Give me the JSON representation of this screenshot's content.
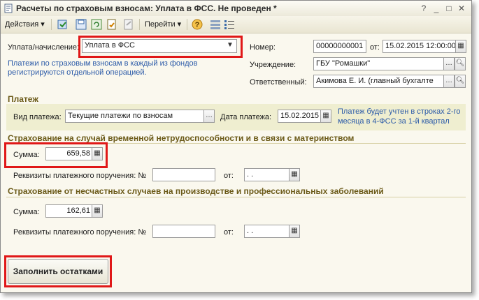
{
  "window": {
    "title": "Расчеты по страховым взносам: Уплата в ФСС. Не проведен *",
    "controls": [
      "?",
      "_",
      "□",
      "✕"
    ]
  },
  "toolbar": {
    "actions_label": "Действия",
    "goto_label": "Перейти"
  },
  "form": {
    "payment_type_label": "Уплата/начисление:",
    "payment_type_value": "Уплата в ФСС",
    "hint": [
      "Платежи по страховым взносам в каждый из фондов",
      "регистрируются отдельной операцией."
    ],
    "number_label": "Номер:",
    "number_value": "00000000001",
    "from_label": "от:",
    "date_value": "15.02.2015 12:00:00",
    "org_label": "Учреждение:",
    "org_value": "ГБУ \"Ромашки\"",
    "resp_label": "Ответственный:",
    "resp_value": "Акимова Е. И. (главный бухгалте"
  },
  "platezh": {
    "title": "Платеж",
    "kind_label": "Вид платежа:",
    "kind_value": "Текущие платежи по взносам",
    "date_label": "Дата платежа:",
    "date_value": "15.02.2015",
    "note": [
      "Платеж будет учтен в строках 2-го",
      "месяца в 4-ФСС за 1-й квартал"
    ]
  },
  "insurance1": {
    "title": "Страхование на случай временной нетрудоспособности и в связи с материнством",
    "sum_label": "Сумма:",
    "sum_value": "659,58",
    "req_label": "Реквизиты платежного поручения: №",
    "from_label": "от:",
    "date_placeholder": " .  ."
  },
  "insurance2": {
    "title": "Страхование от несчастных случаев на производстве и профессиональных заболеваний",
    "sum_label": "Сумма:",
    "sum_value": "162,61",
    "req_label": "Реквизиты платежного поручения: №",
    "from_label": "от:",
    "date_placeholder": " .  ."
  },
  "fill_button": "Заполнить остатками",
  "colors": {
    "highlight": "#e01818",
    "section_title": "#6b5a18",
    "band": "#efeed0",
    "hint_blue": "#2b5aa8"
  }
}
